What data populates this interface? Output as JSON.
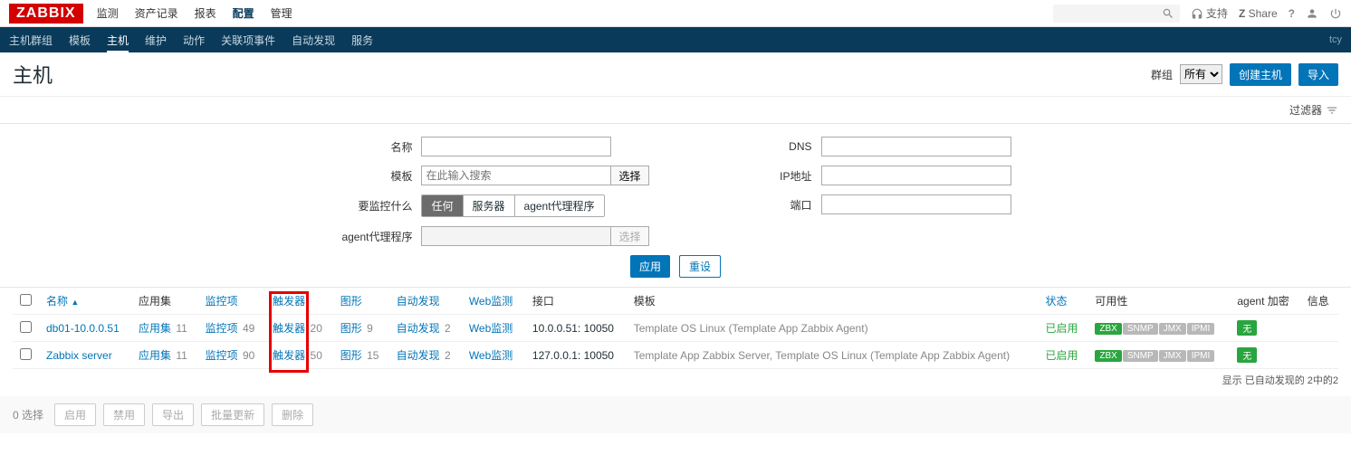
{
  "brand": "ZABBIX",
  "topnav": {
    "items": [
      "监测",
      "资产记录",
      "报表",
      "配置",
      "管理"
    ],
    "activeIndex": 3,
    "support": "支持",
    "share": "Share",
    "search_placeholder": ""
  },
  "subnav": {
    "items": [
      "主机群组",
      "模板",
      "主机",
      "维护",
      "动作",
      "关联项事件",
      "自动发现",
      "服务"
    ],
    "activeIndex": 2,
    "user": "tcy"
  },
  "page": {
    "title": "主机",
    "group_label": "群组",
    "group_options": [
      "所有"
    ],
    "create_btn": "创建主机",
    "import_btn": "导入"
  },
  "filter": {
    "toggle_label": "过滤器",
    "name_label": "名称",
    "template_label": "模板",
    "template_placeholder": "在此输入搜索",
    "template_select_btn": "选择",
    "monitor_label": "要监控什么",
    "monitor_options": [
      "任何",
      "服务器",
      "agent代理程序"
    ],
    "monitor_active": 0,
    "agent_label": "agent代理程序",
    "agent_select_btn": "选择",
    "dns_label": "DNS",
    "ip_label": "IP地址",
    "port_label": "端口",
    "apply_btn": "应用",
    "reset_btn": "重设"
  },
  "table": {
    "headers": {
      "name": "名称",
      "applications": "应用集",
      "items": "监控项",
      "triggers": "触发器",
      "graphs": "图形",
      "discovery": "自动发现",
      "web": "Web监测",
      "interface": "接口",
      "templates": "模板",
      "status": "状态",
      "availability": "可用性",
      "encryption": "agent 加密",
      "info": "信息"
    },
    "rows": [
      {
        "name": "db01-10.0.0.51",
        "applications": {
          "label": "应用集",
          "count": 11
        },
        "items": {
          "label": "监控项",
          "count": 49
        },
        "triggers": {
          "label": "触发器",
          "count": 20
        },
        "graphs": {
          "label": "图形",
          "count": 9
        },
        "discovery": {
          "label": "自动发现",
          "count": 2
        },
        "web": {
          "label": "Web监测",
          "count": ""
        },
        "interface": "10.0.0.51: 10050",
        "templates": "Template OS Linux (Template App Zabbix Agent)",
        "status": "已启用",
        "avail": [
          "ZBX",
          "SNMP",
          "JMX",
          "IPMI"
        ],
        "encryption": "无"
      },
      {
        "name": "Zabbix server",
        "applications": {
          "label": "应用集",
          "count": 11
        },
        "items": {
          "label": "监控项",
          "count": 90
        },
        "triggers": {
          "label": "触发器",
          "count": 50
        },
        "graphs": {
          "label": "图形",
          "count": 15
        },
        "discovery": {
          "label": "自动发现",
          "count": 2
        },
        "web": {
          "label": "Web监测",
          "count": ""
        },
        "interface": "127.0.0.1: 10050",
        "templates": "Template App Zabbix Server, Template OS Linux (Template App Zabbix Agent)",
        "status": "已启用",
        "avail": [
          "ZBX",
          "SNMP",
          "JMX",
          "IPMI"
        ],
        "encryption": "无"
      }
    ],
    "footer": "显示 已自动发现的 2中的2"
  },
  "bottom": {
    "selected": "0 选择",
    "enable": "启用",
    "disable": "禁用",
    "export": "导出",
    "massupdate": "批量更新",
    "delete": "删除"
  }
}
